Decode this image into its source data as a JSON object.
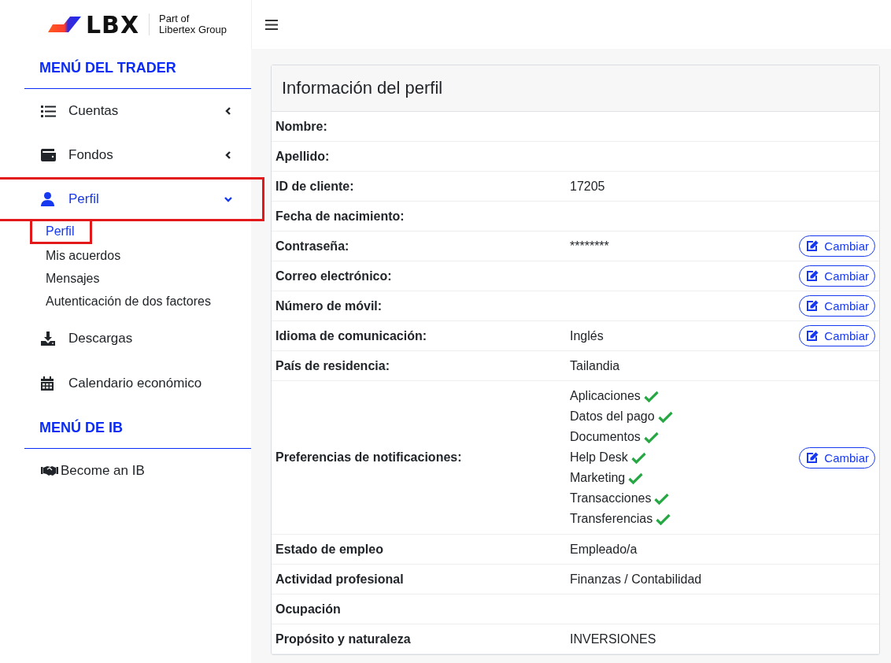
{
  "logo": {
    "wordmark": "LBX",
    "tagline": [
      "Part of",
      "Libertex Group"
    ]
  },
  "sidebar": {
    "items": [
      {
        "kind": "heading",
        "label": "MENÚ DEL TRADER"
      },
      {
        "kind": "item",
        "label": "Cuentas",
        "expanded": false,
        "selected": false,
        "highlighted": false
      },
      {
        "kind": "item",
        "label": "Fondos",
        "expanded": false,
        "selected": false,
        "highlighted": false
      },
      {
        "kind": "item",
        "label": "Perfil",
        "expanded": true,
        "selected": true,
        "highlighted": true
      },
      {
        "kind": "subitem",
        "label": "Perfil",
        "selected": true,
        "highlighted": true
      },
      {
        "kind": "subitem",
        "label": "Mis acuerdos",
        "selected": false,
        "highlighted": false
      },
      {
        "kind": "subitem",
        "label": "Mensajes",
        "selected": false,
        "highlighted": false
      },
      {
        "kind": "subitem",
        "label": "Autenticación de dos factores",
        "selected": false,
        "highlighted": false
      },
      {
        "kind": "link",
        "label": "Descargas"
      },
      {
        "kind": "link",
        "label": "Calendario económico"
      },
      {
        "kind": "heading",
        "label": "MENÚ DE IB"
      },
      {
        "kind": "small",
        "label": "Become an IB"
      }
    ]
  },
  "profile": {
    "title": "Información del perfil",
    "rows": [
      {
        "kind": "text",
        "label": "Nombre:"
      },
      {
        "kind": "text",
        "label": "Apellido:"
      },
      {
        "kind": "text",
        "label": "ID de cliente:",
        "value": "17205"
      },
      {
        "kind": "text",
        "label": "Fecha de nacimiento:"
      },
      {
        "kind": "text",
        "label": "Contraseña:",
        "value": "********",
        "button": "Cambiar"
      },
      {
        "kind": "text",
        "label": "Correo electrónico:",
        "button": "Cambiar"
      },
      {
        "kind": "text",
        "label": "Número de móvil:",
        "button": "Cambiar"
      },
      {
        "kind": "text",
        "label": "Idioma de comunicación:",
        "value": "Inglés",
        "button": "Cambiar"
      },
      {
        "kind": "text",
        "label": "País de residencia:",
        "value": "Tailandia"
      },
      {
        "kind": "list",
        "label": "Preferencias de notificaciones:",
        "button": "Cambiar",
        "options": [
          {
            "label": "Aplicaciones",
            "checked": true
          },
          {
            "label": "Datos del pago",
            "checked": true
          },
          {
            "label": "Documentos",
            "checked": true
          },
          {
            "label": "Help Desk",
            "checked": true
          },
          {
            "label": "Marketing",
            "checked": true
          },
          {
            "label": "Transacciones",
            "checked": true
          },
          {
            "label": "Transferencias",
            "checked": true
          }
        ]
      },
      {
        "kind": "text",
        "label": "Estado de empleo",
        "value": "Empleado/a"
      },
      {
        "kind": "text",
        "label": "Actividad profesional",
        "value": "Finanzas / Contabilidad"
      },
      {
        "kind": "text",
        "label": "Ocupación"
      },
      {
        "kind": "text",
        "label": "Propósito y naturaleza",
        "value": "INVERSIONES"
      }
    ]
  }
}
